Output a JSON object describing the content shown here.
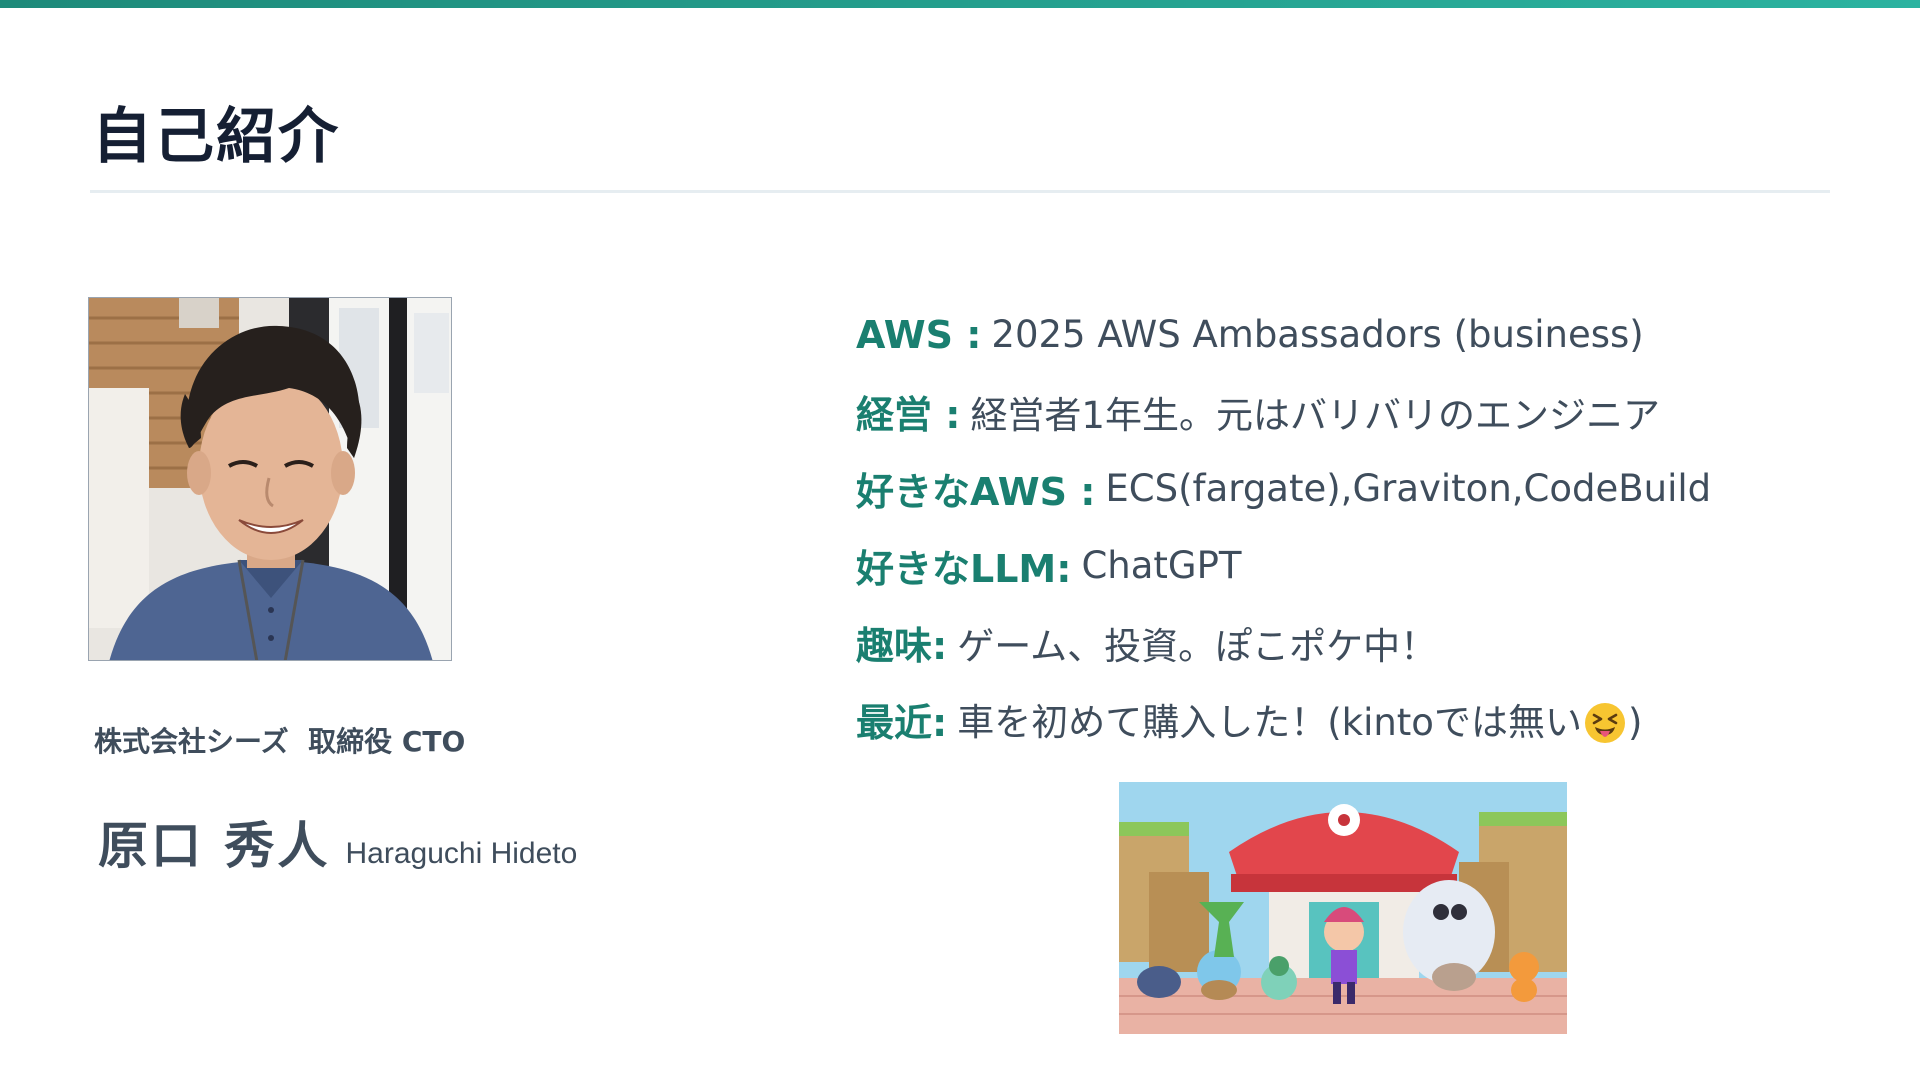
{
  "slide": {
    "title": "自己紹介",
    "accent_color": "#1a7f70",
    "top_bar_gradient": [
      "#1e8a7a",
      "#2bb3a0"
    ]
  },
  "profile": {
    "company_role": "株式会社シーズ  取締役 CTO",
    "name_jp": "原口 秀人",
    "name_en": "Haraguchi Hideto",
    "photo_icon": "profile-photo"
  },
  "facts": [
    {
      "label": "AWS :",
      "value": "2025 AWS Ambassadors (business)"
    },
    {
      "label": "経営 :",
      "value": "経営者1年生。元はバリバリのエンジニア"
    },
    {
      "label": "好きなAWS :",
      "value": "ECS(fargate),Graviton,CodeBuild"
    },
    {
      "label": "好きなLLM:",
      "value": "ChatGPT"
    },
    {
      "label": "趣味:",
      "value": "ゲーム、投資。ぽこポケ中！"
    },
    {
      "label": "最近:",
      "value_before": "車を初めて購入した！(kintoでは無い",
      "emoji": "squinting-face-with-tongue",
      "value_after": ")"
    }
  ],
  "game_image": {
    "icon": "game-screenshot"
  }
}
